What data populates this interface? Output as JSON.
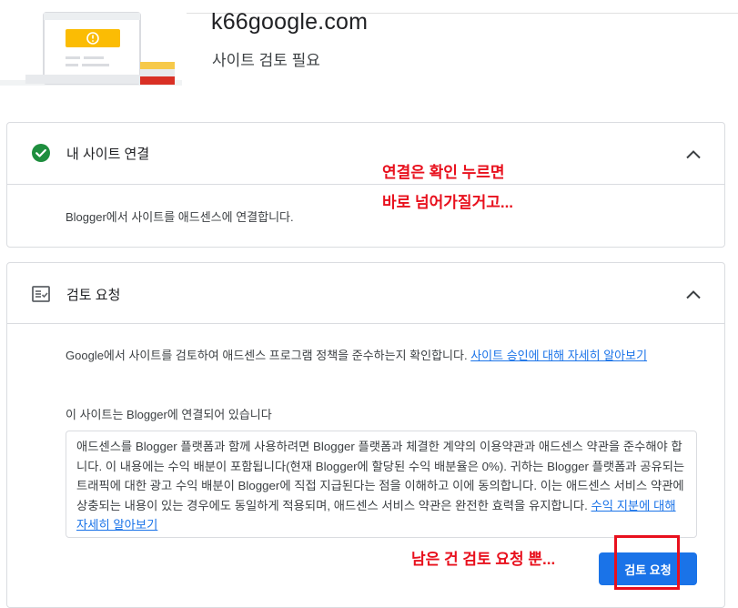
{
  "site": {
    "domain": "k66google.com",
    "status": "사이트 검토 필요"
  },
  "connect_card": {
    "title": "내 사이트 연결",
    "icon": "check-circle-icon",
    "body": "Blogger에서 사이트를 애드센스에 연결합니다.",
    "expanded": true
  },
  "review_card": {
    "title": "검토 요청",
    "icon": "checklist-icon",
    "intro": "Google에서 사이트를 검토하여 애드센스 프로그램 정책을 준수하는지 확인합니다.",
    "intro_link": "사이트 승인에 대해 자세히 알아보기",
    "connected_text": "이 사이트는 Blogger에 연결되어 있습니다",
    "terms_text": "애드센스를 Blogger 플랫폼과 함께 사용하려면 Blogger 플랫폼과 체결한 계약의 이용약관과 애드센스 약관을 준수해야 합니다. 이 내용에는 수익 배분이 포함됩니다(현재 Blogger에 할당된 수익 배분율은 0%). 귀하는 Blogger 플랫폼과 공유되는 트래픽에 대한 광고 수익 배분이 Blogger에 직접 지급된다는 점을 이해하고 이에 동의합니다. 이는 애드센스 서비스 약관에 상충되는 내용이 있는 경우에도 동일하게 적용되며, 애드센스 서비스 약관은 완전한 효력을 유지합니다.",
    "terms_link": "수익 지분에 대해 자세히 알아보기",
    "button_label": "검토 요청",
    "expanded": true
  },
  "annotations": {
    "line1": "연결은 확인 누르면",
    "line2": "바로 넘어가질거고...",
    "line3": "남은 건 검토 요청 뿐..."
  },
  "colors": {
    "accent": "#1a73e8",
    "success": "#1e8e3e",
    "annotation": "#e8101d",
    "warning": "#fbbc04"
  }
}
